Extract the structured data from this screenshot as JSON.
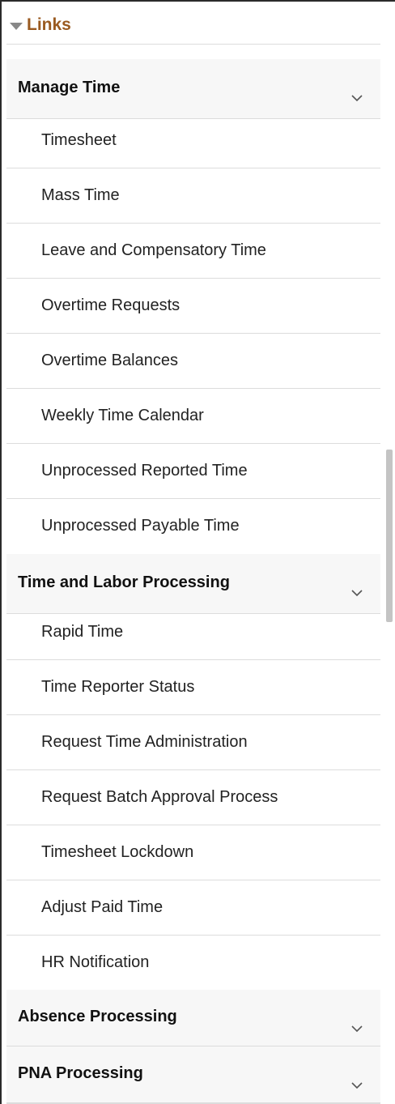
{
  "links": {
    "title": "Links"
  },
  "sections": [
    {
      "title": "Manage Time",
      "items": [
        "Timesheet",
        "Mass Time",
        "Leave and Compensatory Time",
        "Overtime Requests",
        "Overtime Balances",
        "Weekly Time Calendar",
        "Unprocessed Reported Time",
        "Unprocessed Payable Time"
      ]
    },
    {
      "title": "Time and Labor Processing",
      "items": [
        "Rapid Time",
        "Time Reporter Status",
        "Request Time Administration",
        "Request Batch Approval Process",
        "Timesheet Lockdown",
        "Adjust Paid Time",
        "HR Notification"
      ]
    },
    {
      "title": "Absence Processing",
      "items": []
    },
    {
      "title": "PNA Processing",
      "items": []
    }
  ]
}
